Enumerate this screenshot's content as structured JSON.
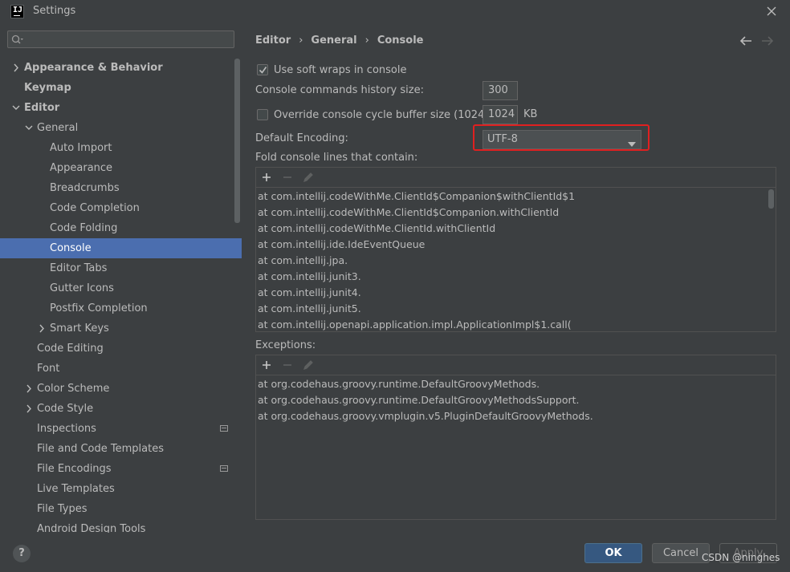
{
  "window": {
    "title": "Settings",
    "app_icon_text": "IJ"
  },
  "search": {
    "placeholder": "",
    "value": ""
  },
  "sidebar": {
    "items": [
      {
        "label": "Appearance & Behavior",
        "level": 0,
        "expandable": true,
        "expanded": false,
        "bold": true
      },
      {
        "label": "Keymap",
        "level": 0,
        "expandable": false,
        "bold": true
      },
      {
        "label": "Editor",
        "level": 0,
        "expandable": true,
        "expanded": true,
        "bold": true
      },
      {
        "label": "General",
        "level": 1,
        "expandable": true,
        "expanded": true
      },
      {
        "label": "Auto Import",
        "level": 2
      },
      {
        "label": "Appearance",
        "level": 2
      },
      {
        "label": "Breadcrumbs",
        "level": 2
      },
      {
        "label": "Code Completion",
        "level": 2
      },
      {
        "label": "Code Folding",
        "level": 2
      },
      {
        "label": "Console",
        "level": 2,
        "selected": true
      },
      {
        "label": "Editor Tabs",
        "level": 2
      },
      {
        "label": "Gutter Icons",
        "level": 2
      },
      {
        "label": "Postfix Completion",
        "level": 2
      },
      {
        "label": "Smart Keys",
        "level": 2,
        "expandable": true,
        "expanded": false
      },
      {
        "label": "Code Editing",
        "level": 1
      },
      {
        "label": "Font",
        "level": 1
      },
      {
        "label": "Color Scheme",
        "level": 1,
        "expandable": true,
        "expanded": false
      },
      {
        "label": "Code Style",
        "level": 1,
        "expandable": true,
        "expanded": false
      },
      {
        "label": "Inspections",
        "level": 1,
        "badge": true
      },
      {
        "label": "File and Code Templates",
        "level": 1
      },
      {
        "label": "File Encodings",
        "level": 1,
        "badge": true
      },
      {
        "label": "Live Templates",
        "level": 1
      },
      {
        "label": "File Types",
        "level": 1
      },
      {
        "label": "Android Design Tools",
        "level": 1
      }
    ]
  },
  "breadcrumb": {
    "items": [
      "Editor",
      "General",
      "Console"
    ],
    "separator": "›"
  },
  "console_settings": {
    "soft_wraps": {
      "label": "Use soft wraps in console",
      "checked": true
    },
    "history_size": {
      "label": "Console commands history size:",
      "value": "300"
    },
    "cycle_buffer": {
      "label": "Override console cycle buffer size (1024 KB)",
      "checked": false,
      "value": "1024",
      "unit": "KB"
    },
    "encoding": {
      "label": "Default Encoding:",
      "value": "UTF-8"
    },
    "fold_label": "Fold console lines that contain:",
    "fold_lines": [
      "at com.intellij.codeWithMe.ClientId$Companion$withClientId$1",
      "at com.intellij.codeWithMe.ClientId$Companion.withClientId",
      "at com.intellij.codeWithMe.ClientId.withClientId",
      "at com.intellij.ide.IdeEventQueue",
      "at com.intellij.jpa.",
      "at com.intellij.junit3.",
      "at com.intellij.junit4.",
      "at com.intellij.junit5.",
      "at com.intellij.openapi.application.impl.ApplicationImpl$1.call("
    ],
    "exceptions_label": "Exceptions:",
    "exception_lines": [
      "at org.codehaus.groovy.runtime.DefaultGroovyMethods.",
      "at org.codehaus.groovy.runtime.DefaultGroovyMethodsSupport.",
      "at org.codehaus.groovy.vmplugin.v5.PluginDefaultGroovyMethods."
    ]
  },
  "buttons": {
    "help": "?",
    "ok": "OK",
    "cancel": "Cancel",
    "apply": "Apply"
  },
  "watermark": "CSDN @ninghes",
  "colors": {
    "background": "#3c3f41",
    "selection": "#4b6eaf",
    "ok_button": "#365880",
    "highlight": "#e02020",
    "text": "#bbbbbb"
  },
  "icons": [
    "app-icon",
    "close-icon",
    "search-icon",
    "chevron-right-icon",
    "chevron-down-icon",
    "arrow-left-icon",
    "arrow-right-icon",
    "add-icon",
    "remove-icon",
    "edit-icon",
    "dropdown-arrow-icon",
    "project-scope-icon",
    "help-icon"
  ]
}
